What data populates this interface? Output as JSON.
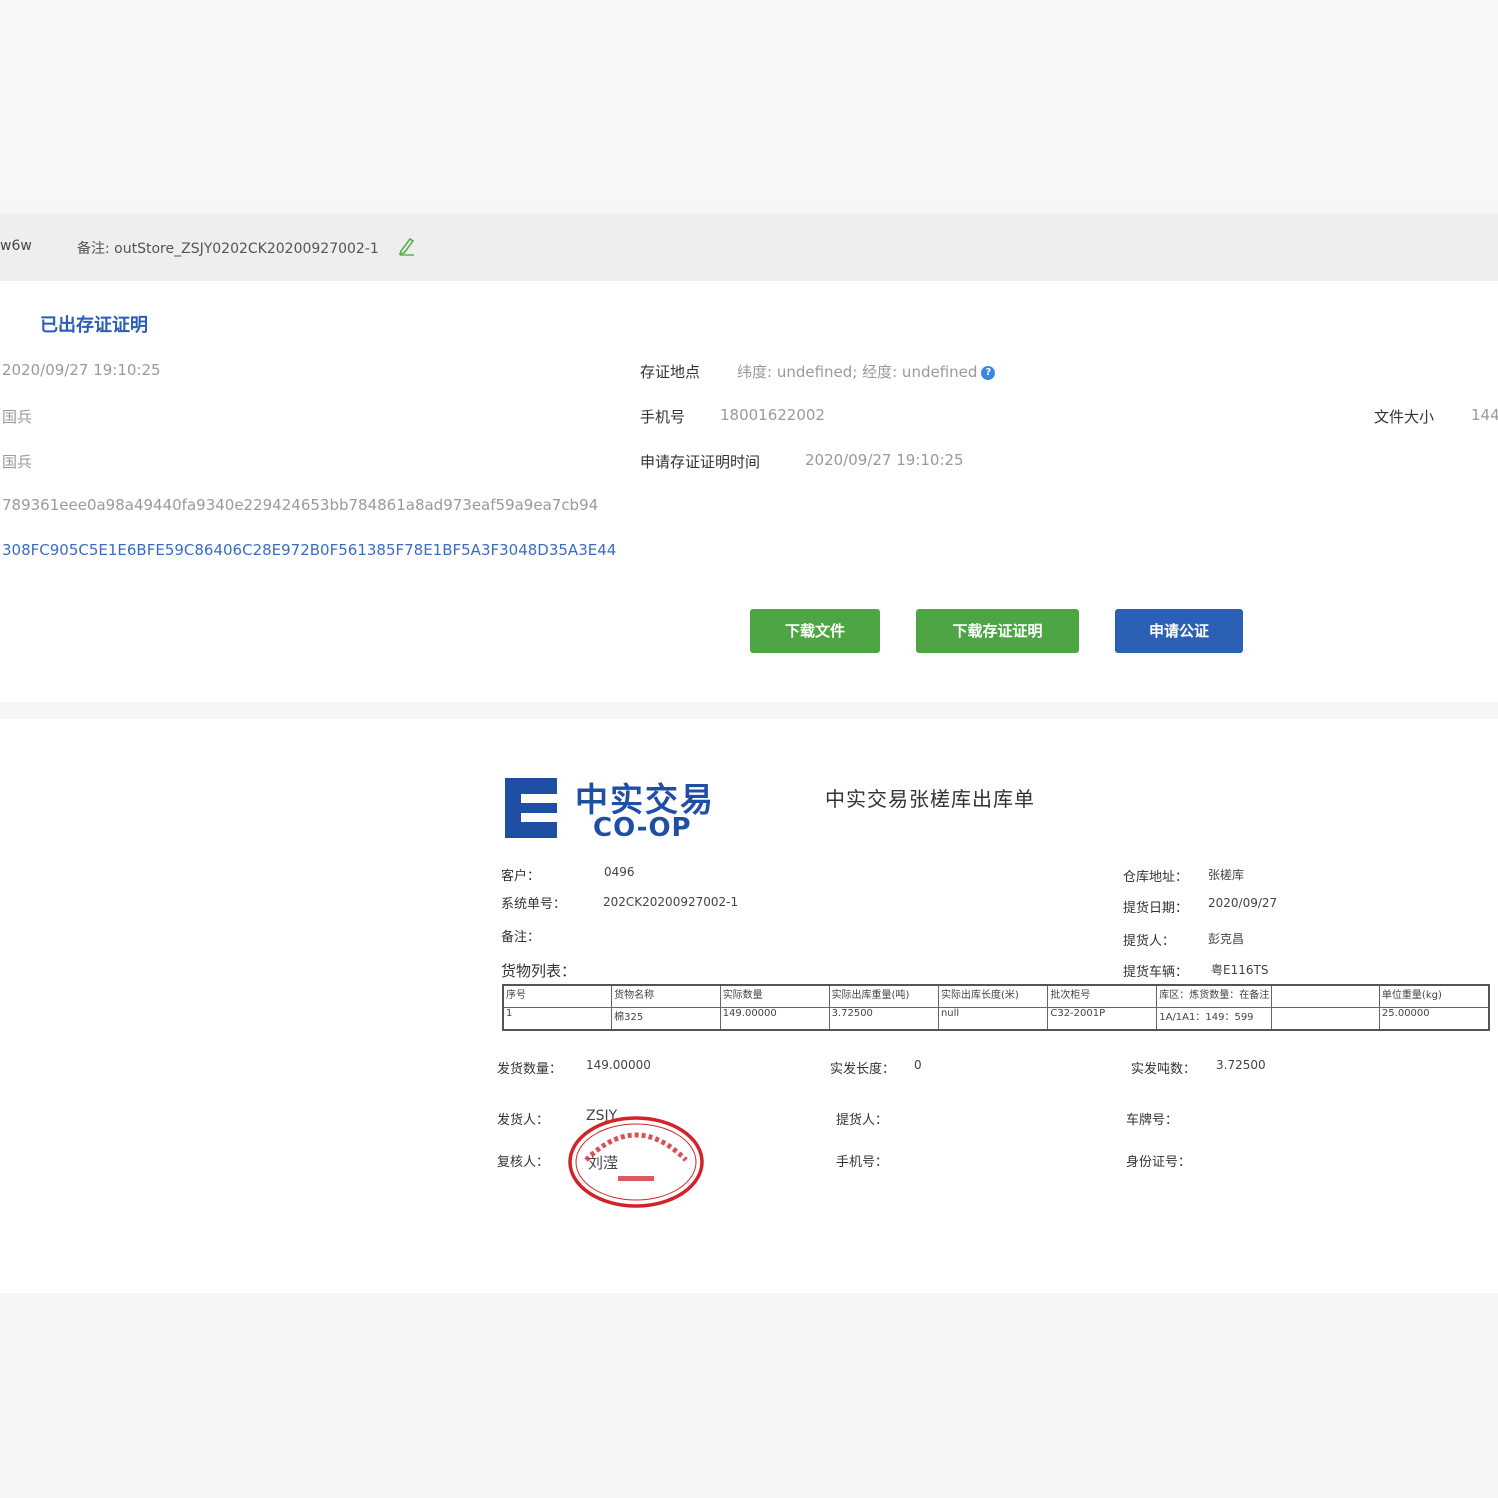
{
  "info_bar": {
    "id_fragment": "w6w",
    "remark_label": "备注:",
    "remark_value": "outStore_ZSJY0202CK20200927002-1",
    "edit_icon": "edit-pencil-icon"
  },
  "card": {
    "section_title": "已出存证证明",
    "left_values": {
      "time": "2020/09/27 19:10:25",
      "name1": "国兵",
      "name2": "国兵",
      "hash": "789361eee0a98a49440fa9340e229424653bb784861a8ad973eaf59a9ea7cb94",
      "tx_id": "308FC905C5E1E6BFE59C86406C28E972B0F561385F78E1BF5A3F3048D35A3E44"
    },
    "location_label": "存证地点",
    "location_value": "纬度: undefined; 经度: undefined",
    "phone_label": "手机号",
    "phone_value": "18001622002",
    "apply_time_label": "申请存证证明时间",
    "apply_time_value": "2020/09/27 19:10:25",
    "file_size_label": "文件大小",
    "file_size_value": "144",
    "buttons": {
      "download_file": "下载文件",
      "download_cert": "下载存证证明",
      "apply_notary": "申请公证"
    }
  },
  "document": {
    "logo_cn": "中实交易",
    "logo_en": "CO-OP",
    "title": "中实交易张槎库出库单",
    "customer_label": "客户：",
    "customer_value": "0496",
    "system_no_label": "系统单号：",
    "system_no_value": "202CK20200927002-1",
    "remark_label": "备注：",
    "goods_list_label": "货物列表：",
    "warehouse_label": "仓库地址：",
    "warehouse_value": "张槎库",
    "pickup_date_label": "提货日期：",
    "pickup_date_value": "2020/09/27",
    "picker_label": "提货人：",
    "picker_value": "彭克昌",
    "vehicle_label": "提货车辆：",
    "vehicle_value": "粤E116TS",
    "table": {
      "headers": [
        "序号",
        "货物名称",
        "实际数量",
        "实际出库重量(吨)",
        "实际出库长度(米)",
        "批次柜号",
        "库区：炼货数量：在备注",
        "",
        "单位重量(kg)"
      ],
      "row": [
        "1",
        "棉325",
        "149.00000",
        "3.72500",
        "null",
        "C32-2001P",
        "1A/1A1：149：599",
        "",
        "25.00000"
      ]
    },
    "ship_qty_label": "发货数量：",
    "ship_qty_value": "149.00000",
    "actual_length_label": "实发长度：",
    "actual_length_value": "0",
    "actual_tons_label": "实发吨数：",
    "actual_tons_value": "3.72500",
    "shipper_label": "发货人：",
    "shipper_value": "ZSJY",
    "picker2_label": "提货人：",
    "plate_label": "车牌号：",
    "reviewer_label": "复核人：",
    "reviewer_value": "刘滢",
    "mobile_label": "手机号：",
    "id_label": "身份证号："
  }
}
